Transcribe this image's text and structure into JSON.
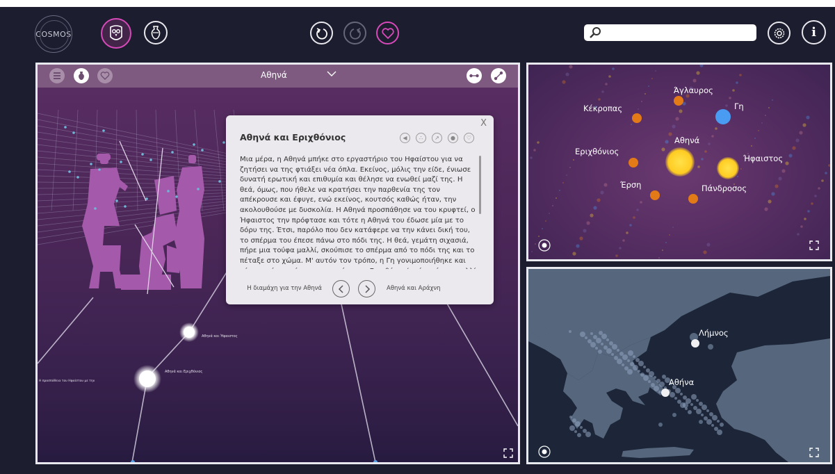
{
  "app": {
    "logo_text": "COSMOS"
  },
  "search": {
    "placeholder": "",
    "value": ""
  },
  "colors": {
    "accent": "#d74ab9",
    "background": "#1c1d2e",
    "figure_purple": "#a559aa",
    "node_orange": "#e37a18",
    "node_yellow": "#ffd12e",
    "node_blue": "#4a9cf3"
  },
  "icons": {
    "logo": "cosmos-logo-icon",
    "owl": "owl-icon",
    "vase": "vase-icon",
    "undo": "undo-icon",
    "redo": "redo-icon",
    "favorite": "heart-icon",
    "search": "search-icon",
    "settings": "gear-icon",
    "info": "info-icon"
  },
  "panel": {
    "title": "Αθηνά",
    "node_labels": {
      "hephaistos": "Αθηνά και Ήφαιστος",
      "erichthonios": "Αθηνά και Εριχθόνιος",
      "side": "Η προσπάθεια του Ηφαίστου με την"
    }
  },
  "story": {
    "title": "Αθηνά και Εριχθόνιος",
    "close": "X",
    "text": "Μια μέρα, η Αθηνά μπήκε στο εργαστήριο του Ηφαίστου για να ζητήσει να της φτιάξει νέα όπλα. Εκείνος, μόλις την είδε, ένιωσε δυνατή ερωτική και επιθυμία και θέλησε να ενωθεί μαζί της. Η θεά, όμως, που ήθελε να κρατήσει την παρθενία της τον απέκρουσε και έφυγε, ενώ εκείνος, κουτσός καθώς ήταν, την ακολουθούσε με δυσκολία. Η Αθηνά προσπάθησε να του κρυφτεί, ο Ήφαιστος την πρόφτασε και τότε η Αθηνά του έδωσε μία με το δόρυ της. Έτσι, παρόλο που δεν κατάφερε να την κάνει δική του, το σπέρμα του έπεσε πάνω στο πόδι της. Η θεά, γεμάτη σιχασιά, πήρε μια τούφα μαλλί, σκούπισε το σπέρμα από το πόδι της και το πέταξε στο χώμα. Μ' αυτόν τον τρόπο, η Γη γονιμοποιήθηκε και γέννησε ένα αγόρι που το ονόμασαν Εριχθόνιο (από το έριο=μαλλί και χθων=γη). Η Γη έδωσε το παιδί στην Αθηνά.",
    "prev_label": "Η διαμάχη για την Αθηνά",
    "next_label": "Αθηνά και Αράχνη"
  },
  "graph": {
    "nodes": [
      {
        "label": "Άγλαυρος"
      },
      {
        "label": "Κέκροπας"
      },
      {
        "label": "Γη"
      },
      {
        "label": "Αθηνά"
      },
      {
        "label": "Εριχθόνιος"
      },
      {
        "label": "Ήφαιστος"
      },
      {
        "label": "Έρση"
      },
      {
        "label": "Πάνδροσος"
      }
    ]
  },
  "map": {
    "places": [
      {
        "label": "Λήμνος"
      },
      {
        "label": "Αθήνα"
      }
    ]
  }
}
